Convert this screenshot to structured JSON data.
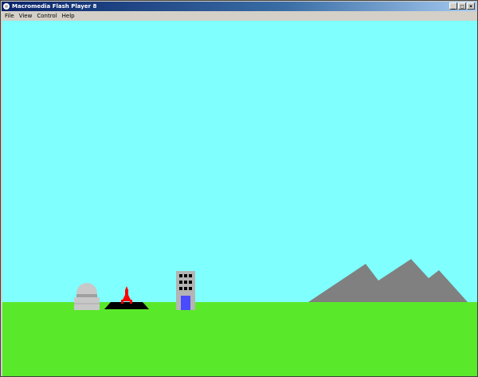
{
  "window": {
    "title": "Macromedia Flash Player 8",
    "controls": {
      "minimize": "_",
      "maximize": "□",
      "close": "×"
    }
  },
  "menu": {
    "items": [
      {
        "label": "File"
      },
      {
        "label": "View"
      },
      {
        "label": "Control"
      },
      {
        "label": "Help"
      }
    ]
  },
  "scene": {
    "sky_color": "#80ffff",
    "ground_color": "#5ae82a",
    "mountain_color": "#808080",
    "launch_pad_color": "#000000",
    "rocket_color": "#ff0000",
    "observatory_color": "#c8c8c8",
    "building_color": "#b4b4b4",
    "building_door_color": "#4a4aff",
    "building_window_color": "#000000"
  },
  "icons": {
    "app": "flash-player-icon",
    "minimize": "minimize-icon",
    "maximize": "maximize-icon",
    "close": "close-icon"
  }
}
